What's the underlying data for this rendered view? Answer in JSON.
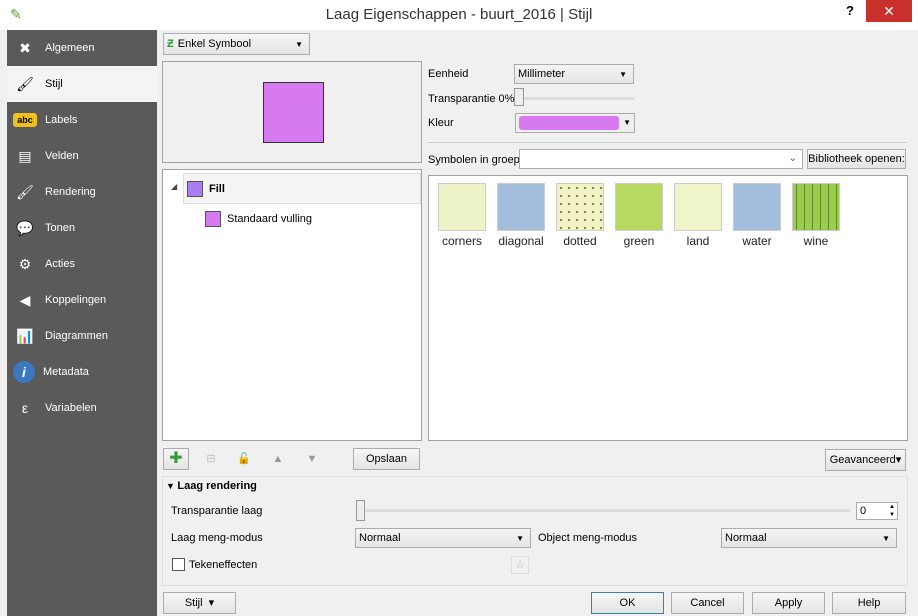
{
  "window": {
    "title": "Laag Eigenschappen - buurt_2016 | Stijl",
    "help": "?",
    "close": "✕"
  },
  "sidebar": {
    "items": [
      {
        "label": "Algemeen",
        "icon": "tools-icon",
        "glyph": "✖"
      },
      {
        "label": "Stijl",
        "icon": "paintbrush-icon",
        "glyph": "🖌"
      },
      {
        "label": "Labels",
        "icon": "abc-label-icon",
        "glyph": "abc"
      },
      {
        "label": "Velden",
        "icon": "table-icon",
        "glyph": "▤"
      },
      {
        "label": "Rendering",
        "icon": "brush-icon",
        "glyph": "🖌"
      },
      {
        "label": "Tonen",
        "icon": "speech-bubble-icon",
        "glyph": "💬"
      },
      {
        "label": "Acties",
        "icon": "gear-icon",
        "glyph": "⚙"
      },
      {
        "label": "Koppelingen",
        "icon": "join-icon",
        "glyph": "◀"
      },
      {
        "label": "Diagrammen",
        "icon": "diagram-icon",
        "glyph": "📊"
      },
      {
        "label": "Metadata",
        "icon": "info-icon",
        "glyph": "i"
      },
      {
        "label": "Variabelen",
        "icon": "epsilon-icon",
        "glyph": "ε"
      }
    ],
    "selected": "Stijl"
  },
  "renderer": {
    "value": "Enkel Symbool"
  },
  "symbol": {
    "color": "#d77af0",
    "layers": [
      {
        "label": "Fill",
        "color": "#a97ef0"
      },
      {
        "label": "Standaard vulling",
        "color": "#d77af0"
      }
    ]
  },
  "props": {
    "unit_label": "Eenheid",
    "unit_value": "Millimeter",
    "transp_label": "Transparantie 0%",
    "transp_value": 0,
    "color_label": "Kleur"
  },
  "library": {
    "group_label": "Symbolen in groep",
    "group_value": "",
    "open_button": "Bibliotheek openen:",
    "symbols": [
      {
        "name": "corners",
        "color": "#eef4c8"
      },
      {
        "name": "diagonal",
        "color": "#a3bedd"
      },
      {
        "name": "dotted",
        "color": "#f2f2c4"
      },
      {
        "name": "green",
        "color": "#b7d961"
      },
      {
        "name": "land",
        "color": "#eff4c9"
      },
      {
        "name": "water",
        "color": "#a3bedd"
      },
      {
        "name": "wine",
        "color": "#9ccc4c"
      }
    ]
  },
  "toolbar": {
    "save": "Opslaan",
    "advanced": "Geavanceerd"
  },
  "layer_rendering": {
    "header": "Laag rendering",
    "transp_label": "Transparantie laag",
    "transp_value": "0",
    "blend_label": "Laag meng-modus",
    "blend_value": "Normaal",
    "obj_blend_label": "Object meng-modus",
    "obj_blend_value": "Normaal",
    "effects_label": "Tekeneffecten",
    "effects_checked": false
  },
  "footer": {
    "style": "Stijl",
    "ok": "OK",
    "cancel": "Cancel",
    "apply": "Apply",
    "help": "Help"
  }
}
